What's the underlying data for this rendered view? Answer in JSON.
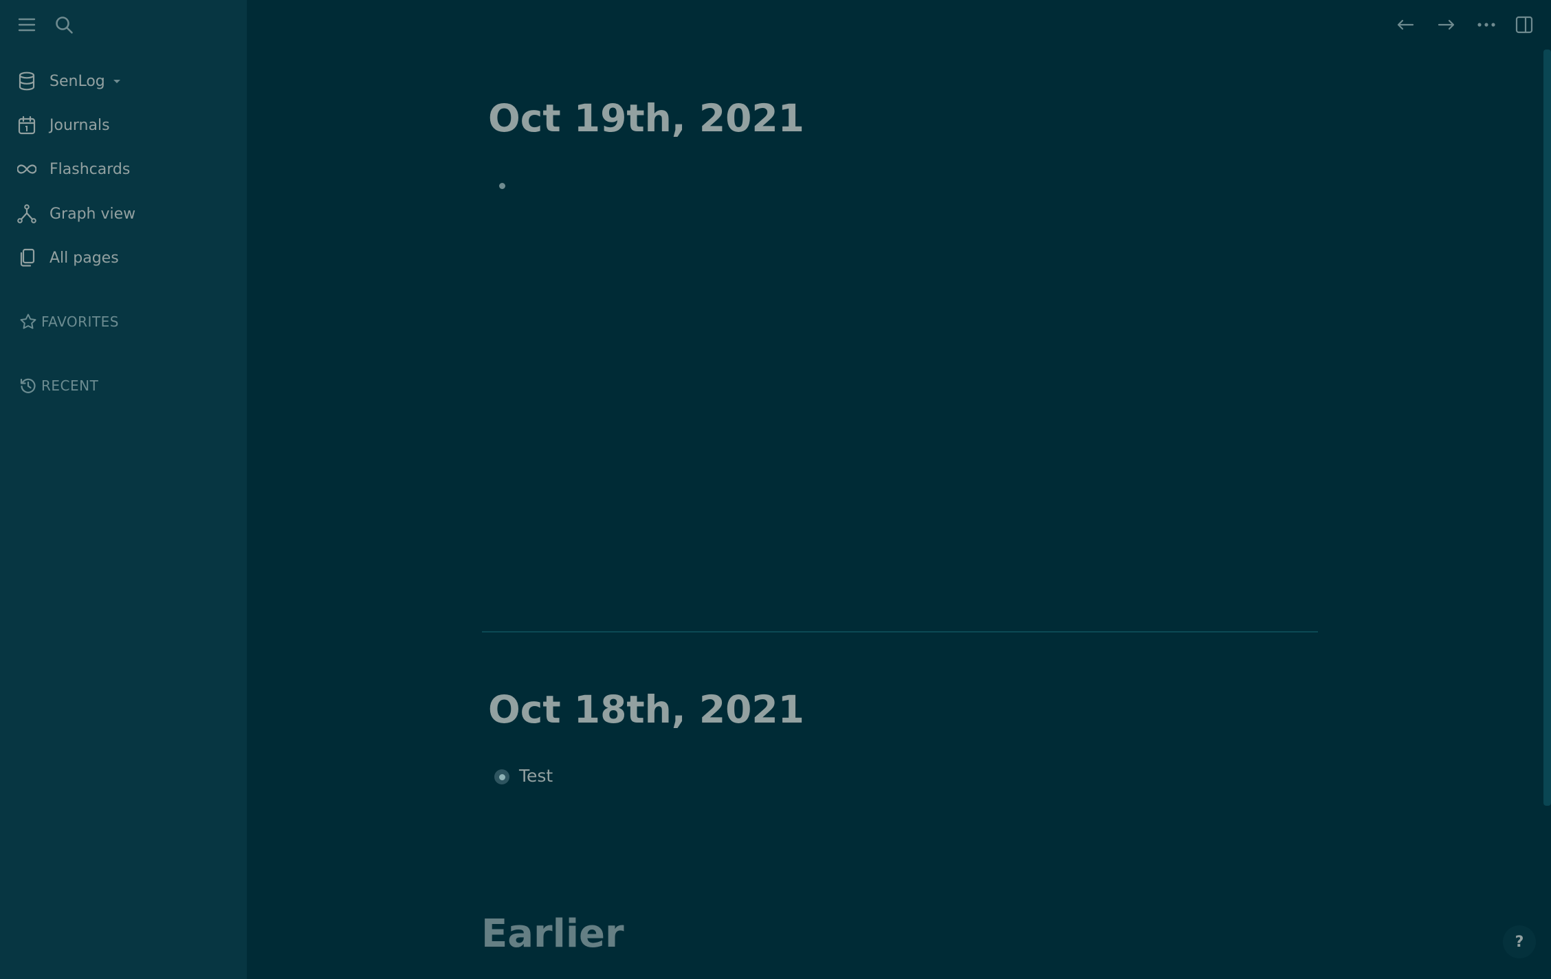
{
  "sidebar": {
    "graph_name": "SenLog",
    "items": [
      {
        "label": "Journals",
        "icon": "calendar-icon"
      },
      {
        "label": "Flashcards",
        "icon": "infinity-icon"
      },
      {
        "label": "Graph view",
        "icon": "graph-icon"
      },
      {
        "label": "All pages",
        "icon": "pages-icon"
      }
    ],
    "favorites_label": "FAVORITES",
    "recent_label": "RECENT"
  },
  "journals": [
    {
      "title": "Oct 19th, 2021",
      "blocks": []
    },
    {
      "title": "Oct 18th, 2021",
      "blocks": [
        "Test"
      ]
    }
  ],
  "earlier_label": "Earlier",
  "help_label": "?",
  "colors": {
    "sidebar_bg": "#073642",
    "main_bg": "#002b36",
    "text": "#93a1a1",
    "muted": "#6c8c91"
  }
}
